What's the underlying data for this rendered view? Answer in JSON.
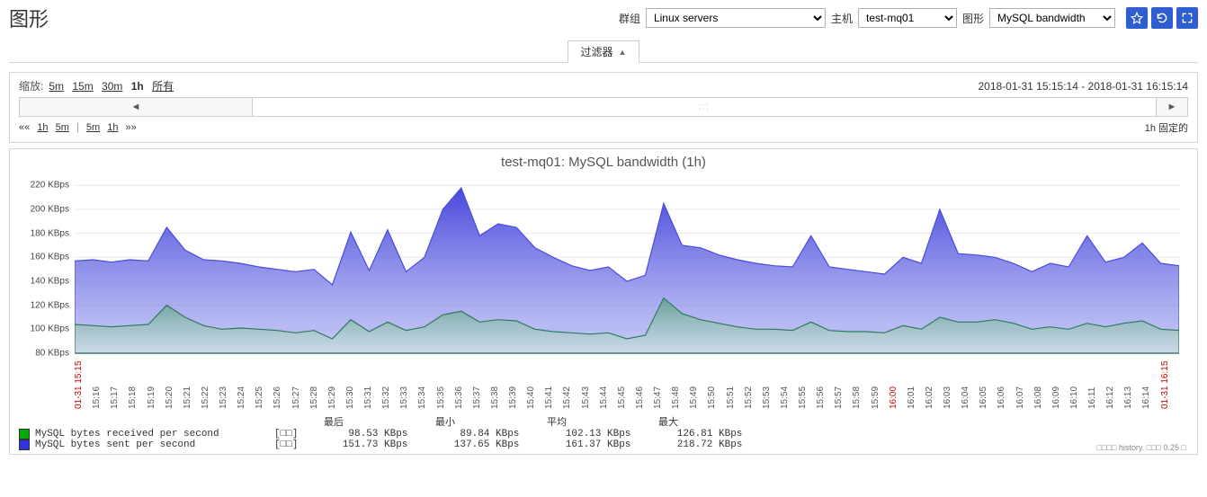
{
  "header": {
    "page_title": "图形",
    "group_label": "群组",
    "host_label": "主机",
    "graph_label": "图形",
    "group_options": [
      "Linux servers"
    ],
    "host_options": [
      "test-mq01"
    ],
    "graph_options": [
      "MySQL bandwidth"
    ]
  },
  "filter": {
    "tab_label": "过滤器"
  },
  "toolbar": {
    "zoom_label": "缩放:",
    "zoom_5m": "5m",
    "zoom_15m": "15m",
    "zoom_30m": "30m",
    "zoom_1h": "1h",
    "zoom_all": "所有",
    "time_range": "2018-01-31 15:15:14 - 2018-01-31 16:15:14",
    "nav_back_1h": "1h",
    "nav_back_5m": "5m",
    "nav_fwd_5m": "5m",
    "nav_fwd_1h": "1h",
    "fixed_label": "1h  固定的",
    "dbl_left": "««",
    "dbl_right": "»»",
    "bar_sep": "|"
  },
  "chart_meta": {
    "title": "test-mq01: MySQL bandwidth (1h)",
    "footer": "□□□□ history. □□□ 0.25 □"
  },
  "legend": {
    "series1_name": "MySQL bytes received per second",
    "series2_name": "MySQL bytes sent per second",
    "col_last": "最后",
    "col_min": "最小",
    "col_avg": "平均",
    "col_max": "最大",
    "brackets": "[□□]",
    "s1_last": "98.53 KBps",
    "s1_min": "89.84 KBps",
    "s1_avg": "102.13 KBps",
    "s1_max": "126.81 KBps",
    "s2_last": "151.73 KBps",
    "s2_min": "137.65 KBps",
    "s2_avg": "161.37 KBps",
    "s2_max": "218.72 KBps",
    "s1_color": "#00AA00",
    "s2_color": "#3333DD"
  },
  "yaxis_ticks": [
    "80 KBps",
    "100 KBps",
    "120 KBps",
    "140 KBps",
    "160 KBps",
    "180 KBps",
    "200 KBps",
    "220 KBps"
  ],
  "xaxis_ticks": [
    {
      "label": "01-31 15:15",
      "red": true
    },
    {
      "label": "15:16"
    },
    {
      "label": "15:17"
    },
    {
      "label": "15:18"
    },
    {
      "label": "15:19"
    },
    {
      "label": "15:20"
    },
    {
      "label": "15:21"
    },
    {
      "label": "15:22"
    },
    {
      "label": "15:23"
    },
    {
      "label": "15:24"
    },
    {
      "label": "15:25"
    },
    {
      "label": "15:26"
    },
    {
      "label": "15:27"
    },
    {
      "label": "15:28"
    },
    {
      "label": "15:29"
    },
    {
      "label": "15:30"
    },
    {
      "label": "15:31"
    },
    {
      "label": "15:32"
    },
    {
      "label": "15:33"
    },
    {
      "label": "15:34"
    },
    {
      "label": "15:35"
    },
    {
      "label": "15:36"
    },
    {
      "label": "15:37"
    },
    {
      "label": "15:38"
    },
    {
      "label": "15:39"
    },
    {
      "label": "15:40"
    },
    {
      "label": "15:41"
    },
    {
      "label": "15:42"
    },
    {
      "label": "15:43"
    },
    {
      "label": "15:44"
    },
    {
      "label": "15:45"
    },
    {
      "label": "15:46"
    },
    {
      "label": "15:47"
    },
    {
      "label": "15:48"
    },
    {
      "label": "15:49"
    },
    {
      "label": "15:50"
    },
    {
      "label": "15:51"
    },
    {
      "label": "15:52"
    },
    {
      "label": "15:53"
    },
    {
      "label": "15:54"
    },
    {
      "label": "15:55"
    },
    {
      "label": "15:56"
    },
    {
      "label": "15:57"
    },
    {
      "label": "15:58"
    },
    {
      "label": "15:59"
    },
    {
      "label": "16:00",
      "red": true
    },
    {
      "label": "16:01"
    },
    {
      "label": "16:02"
    },
    {
      "label": "16:03"
    },
    {
      "label": "16:04"
    },
    {
      "label": "16:05"
    },
    {
      "label": "16:06"
    },
    {
      "label": "16:07"
    },
    {
      "label": "16:08"
    },
    {
      "label": "16:09"
    },
    {
      "label": "16:10"
    },
    {
      "label": "16:11"
    },
    {
      "label": "16:12"
    },
    {
      "label": "16:13"
    },
    {
      "label": "16:14"
    },
    {
      "label": "01-31 16:15",
      "red": true
    }
  ],
  "chart_data": {
    "type": "area",
    "title": "test-mq01: MySQL bandwidth (1h)",
    "xlabel": "",
    "ylabel": "KBps",
    "ylim": [
      80,
      230
    ],
    "x": [
      "15:15",
      "15:16",
      "15:17",
      "15:18",
      "15:19",
      "15:20",
      "15:21",
      "15:22",
      "15:23",
      "15:24",
      "15:25",
      "15:26",
      "15:27",
      "15:28",
      "15:29",
      "15:30",
      "15:31",
      "15:32",
      "15:33",
      "15:34",
      "15:35",
      "15:36",
      "15:37",
      "15:38",
      "15:39",
      "15:40",
      "15:41",
      "15:42",
      "15:43",
      "15:44",
      "15:45",
      "15:46",
      "15:47",
      "15:48",
      "15:49",
      "15:50",
      "15:51",
      "15:52",
      "15:53",
      "15:54",
      "15:55",
      "15:56",
      "15:57",
      "15:58",
      "15:59",
      "16:00",
      "16:01",
      "16:02",
      "16:03",
      "16:04",
      "16:05",
      "16:06",
      "16:07",
      "16:08",
      "16:09",
      "16:10",
      "16:11",
      "16:12",
      "16:13",
      "16:14",
      "16:15"
    ],
    "series": [
      {
        "name": "MySQL bytes sent per second",
        "color": "#4a4ae0",
        "fill": "url(#gradSent)",
        "values": [
          157,
          158,
          156,
          158,
          157,
          185,
          166,
          158,
          157,
          155,
          152,
          150,
          148,
          150,
          137,
          181,
          149,
          183,
          148,
          160,
          200,
          218,
          178,
          188,
          185,
          168,
          160,
          153,
          149,
          152,
          140,
          145,
          205,
          170,
          168,
          162,
          158,
          155,
          153,
          152,
          178,
          152,
          150,
          148,
          146,
          160,
          155,
          200,
          163,
          162,
          160,
          155,
          148,
          155,
          152,
          178,
          156,
          160,
          172,
          155,
          153
        ]
      },
      {
        "name": "MySQL bytes received per second",
        "color": "#2e7a5c",
        "fill": "url(#gradRecv)",
        "values": [
          104,
          103,
          102,
          103,
          104,
          120,
          110,
          103,
          100,
          101,
          100,
          99,
          97,
          99,
          92,
          108,
          98,
          106,
          99,
          102,
          112,
          115,
          106,
          108,
          107,
          100,
          98,
          97,
          96,
          97,
          92,
          95,
          126,
          113,
          108,
          105,
          102,
          100,
          100,
          99,
          106,
          99,
          98,
          98,
          97,
          103,
          100,
          110,
          106,
          106,
          108,
          105,
          100,
          102,
          100,
          105,
          102,
          105,
          107,
          100,
          99
        ]
      }
    ]
  }
}
